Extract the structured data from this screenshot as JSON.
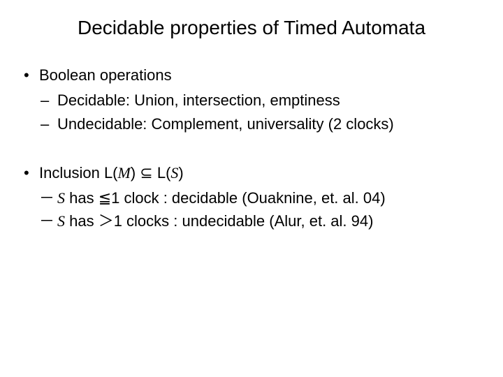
{
  "title": "Decidable properties of Timed Automata",
  "b1": {
    "heading": "Boolean operations",
    "sub1": "Decidable: Union, intersection, emptiness",
    "sub2": "Undecidable: Complement, universality (2 clocks)"
  },
  "b2": {
    "heading_pre": "Inclusion L(",
    "heading_M": "M",
    "heading_mid": ") ⊆ L(",
    "heading_S": "S",
    "heading_post": ")",
    "sub1_S": "S",
    "sub1_rest": " has ≦1 clock : decidable (Ouaknine, et. al. 04)",
    "sub2_S": "S",
    "sub2_rest": " has ＞1 clocks : undecidable (Alur, et. al. 94)"
  }
}
